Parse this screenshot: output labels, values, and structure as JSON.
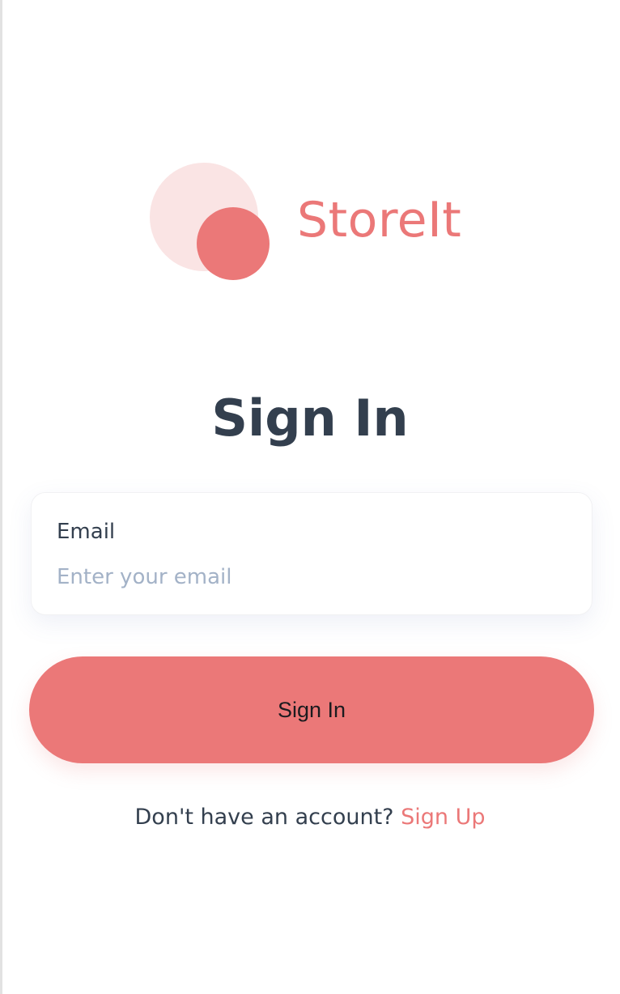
{
  "brand": {
    "name": "StoreIt",
    "logo_icon": "two-circles-logo-icon",
    "color_primary": "#eb7878",
    "color_secondary": "#fae4e4"
  },
  "form": {
    "title": "Sign In",
    "email": {
      "label": "Email",
      "value": "",
      "placeholder": "Enter your email"
    },
    "submit_label": "Sign In"
  },
  "footer": {
    "prompt": "Don't have an account?",
    "link_label": "Sign Up"
  },
  "colors": {
    "heading": "#333f4e",
    "placeholder": "#a3b2c7",
    "background": "#ffffff"
  }
}
